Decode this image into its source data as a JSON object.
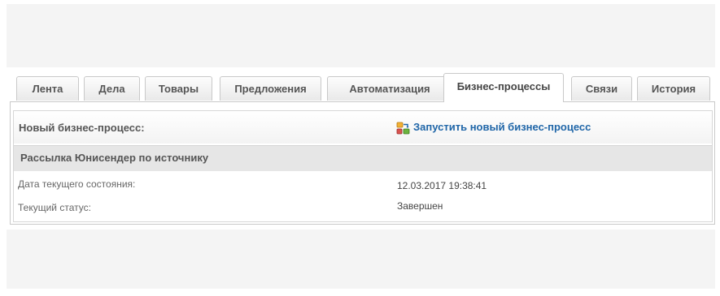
{
  "tabs": [
    {
      "label": "Лента",
      "active": false
    },
    {
      "label": "Дела",
      "active": false
    },
    {
      "label": "Товары",
      "active": false
    },
    {
      "label": "Предложения",
      "active": false
    },
    {
      "label": "Автоматизация",
      "active": false
    },
    {
      "label": "Бизнес-процессы",
      "active": true
    },
    {
      "label": "Связи",
      "active": false
    },
    {
      "label": "История",
      "active": false
    }
  ],
  "new_process": {
    "label": "Новый бизнес-процесс:",
    "start_link": "Запустить новый бизнес-процесс",
    "icon": "business-process-icon"
  },
  "process": {
    "title": "Рассылка Юнисендер по источнику",
    "fields": [
      {
        "label": "Дата текущего состояния:",
        "value": "12.03.2017 19:38:41"
      },
      {
        "label": "Текущий статус:",
        "value": "Завершен"
      }
    ]
  },
  "colors": {
    "link": "#2066a8",
    "section_background": "#e6e6e6",
    "page_background": "#f4f4f4"
  }
}
